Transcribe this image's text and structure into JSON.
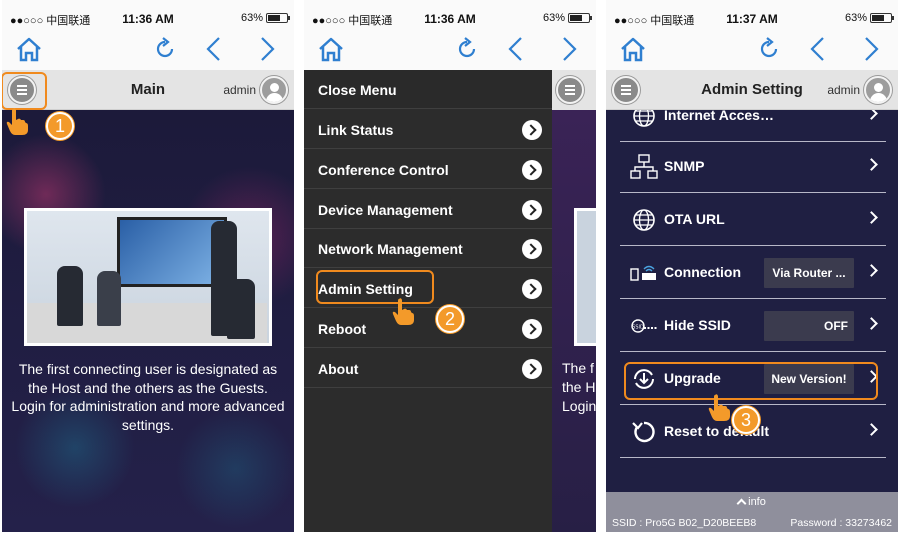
{
  "status": {
    "carrier": "●●○○○ 中国联通",
    "battery": "63%",
    "times": [
      "11:36 AM",
      "11:36 AM",
      "11:37 AM"
    ]
  },
  "screen1": {
    "title": "Main",
    "user": "admin",
    "caption": [
      "The first connecting user is designated as",
      "the Host and the others as the Guests.",
      "Login for administration and more advanced",
      "settings."
    ]
  },
  "screen2": {
    "menu": [
      "Close Menu",
      "Link Status",
      "Conference Control",
      "Device Management",
      "Network Management",
      "Admin Setting",
      "Reboot",
      "About"
    ],
    "peek_text": [
      "The f",
      "the H",
      "Login"
    ]
  },
  "screen3": {
    "title": "Admin Setting",
    "user": "admin",
    "rows": [
      {
        "label": "Internet Acces…",
        "value": "",
        "icon": "globe-icon"
      },
      {
        "label": "SNMP",
        "value": "",
        "icon": "network-icon"
      },
      {
        "label": "OTA URL",
        "value": "",
        "icon": "globe-icon"
      },
      {
        "label": "Connection",
        "value": "Via Router ...",
        "icon": "router-icon"
      },
      {
        "label": "Hide SSID",
        "value": "OFF",
        "icon": "ssid-icon"
      },
      {
        "label": "Upgrade",
        "value": "New Version!",
        "icon": "upgrade-icon"
      },
      {
        "label": "Reset to default",
        "value": "",
        "icon": "reset-icon"
      }
    ],
    "footer": {
      "info": "info",
      "ssid": "SSID : Pro5G B02_D20BEEB8",
      "password": "Password : 33273462"
    }
  },
  "steps": [
    "1",
    "2",
    "3"
  ],
  "colors": {
    "accent": "#f08a1e",
    "nav_blue": "#2f7fd0",
    "menu_bg": "#2c2c2c",
    "list_bg": "#1f1f42"
  }
}
